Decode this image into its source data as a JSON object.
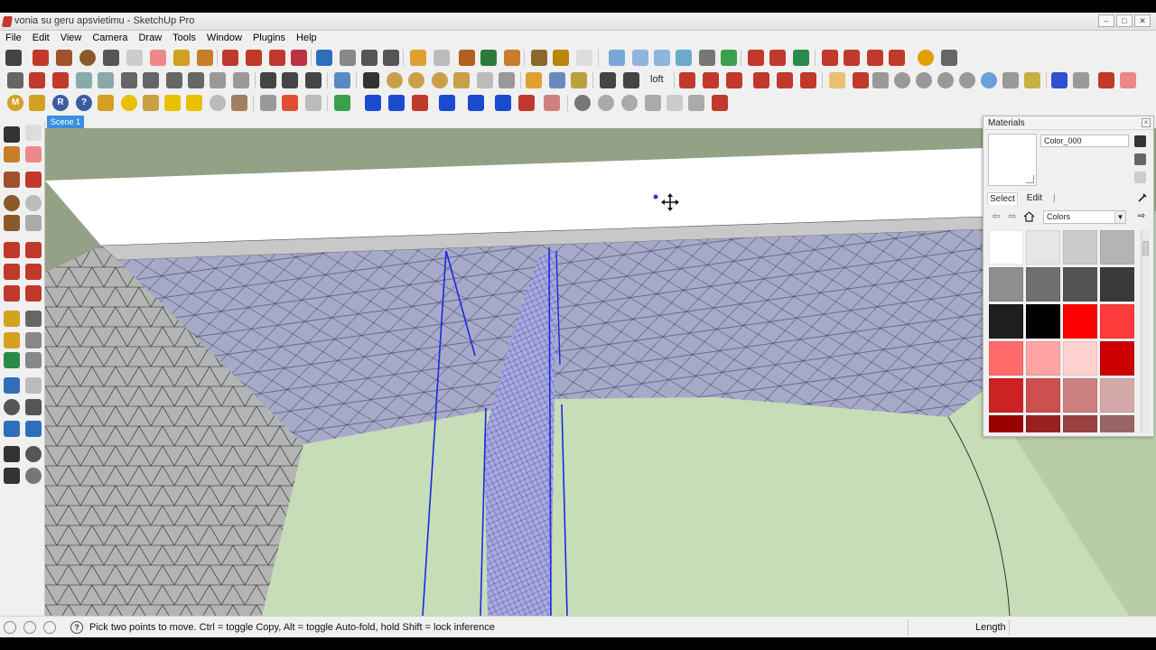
{
  "window": {
    "title": "vonia su geru apsvietimu - SketchUp Pro",
    "controls": [
      "–",
      "□",
      "✕"
    ]
  },
  "menu": [
    "File",
    "Edit",
    "View",
    "Camera",
    "Draw",
    "Tools",
    "Window",
    "Plugins",
    "Help"
  ],
  "toolbar": {
    "loft_label": "loft"
  },
  "scene": {
    "tab_label": "Scene 1"
  },
  "materials": {
    "title": "Materials",
    "close_label": "×",
    "material_name": "Color_000",
    "tabs": {
      "select": "Select",
      "edit": "Edit"
    },
    "library": "Colors",
    "swatches": [
      "#ffffff",
      "#e6e6e6",
      "#cccccc",
      "#b4b4b4",
      "#8e8e8e",
      "#6f6f6f",
      "#545454",
      "#3a3a3a",
      "#1e1e1e",
      "#000000",
      "#ff0000",
      "#ff3a3a",
      "#ff6b6b",
      "#ffa3a3",
      "#ffd0d0",
      "#cc0000",
      "#cc2222",
      "#cc5050",
      "#cc8080",
      "#d4a8a8",
      "#990000",
      "#992020",
      "#994040",
      "#996666"
    ]
  },
  "status": {
    "text": "Pick two points to move.  Ctrl = toggle Copy, Alt = toggle Auto-fold, hold Shift = lock inference",
    "help_label": "?",
    "measure_label": "Length"
  }
}
